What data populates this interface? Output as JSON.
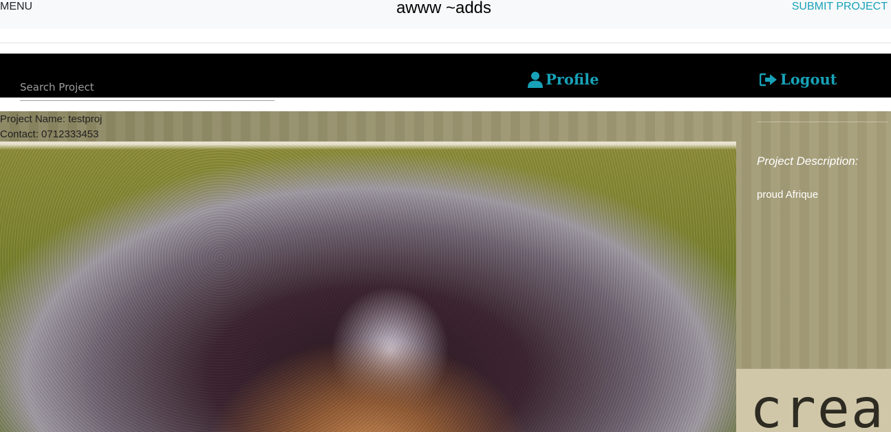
{
  "header": {
    "menu_label": "MENU",
    "brand": "awww ~adds",
    "submit_label": "SUBMIT PROJECT"
  },
  "navbar": {
    "search_placeholder": "Search Project",
    "profile_label": "Profile",
    "profile_icon": "user-icon",
    "logout_label": "Logout",
    "logout_icon": "sign-out-icon"
  },
  "project": {
    "name_line": "Project Name: testproj",
    "contact_line": "Contact: 0712333453",
    "description_heading": "Project Description:",
    "description_text": "proud Afrique"
  },
  "background": {
    "text": "crea"
  },
  "colors": {
    "accent": "#17a2b8",
    "navbar_bg": "#000000",
    "topbar_bg": "#f8f9fa"
  }
}
